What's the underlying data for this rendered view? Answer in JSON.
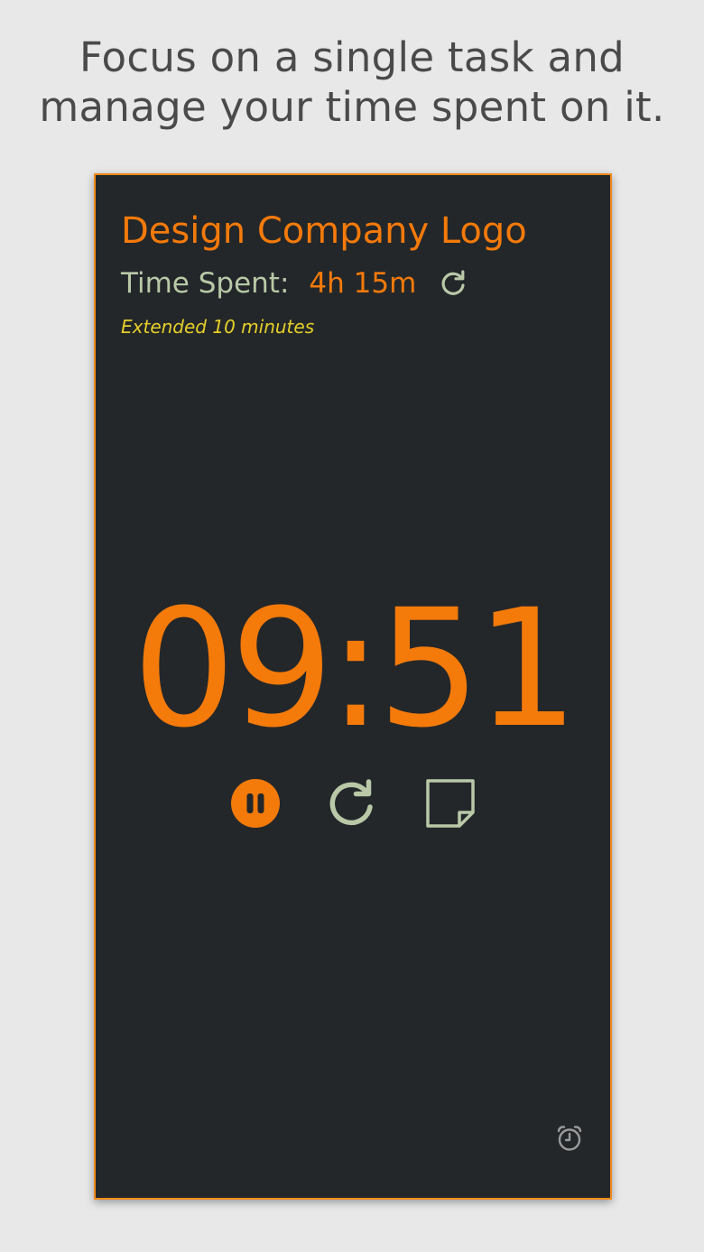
{
  "promo": {
    "line1": "Focus on a single task and",
    "line2": "manage your time spent on it."
  },
  "task": {
    "title": "Design Company Logo",
    "time_spent_label": "Time Spent:",
    "time_spent_value": "4h 15m",
    "extended_note": "Extended 10 minutes"
  },
  "timer": {
    "display": "09:51"
  },
  "controls": {
    "pause_icon": "pause-icon",
    "restart_icon": "restart-icon",
    "notes_icon": "note-icon",
    "alarm_icon": "alarm-clock-icon"
  },
  "colors": {
    "accent": "#f47a0a",
    "muted_green": "#b9c8a7",
    "note_yellow": "#e6cf29",
    "panel_bg": "#23272a",
    "page_bg": "#e8e8e8"
  }
}
